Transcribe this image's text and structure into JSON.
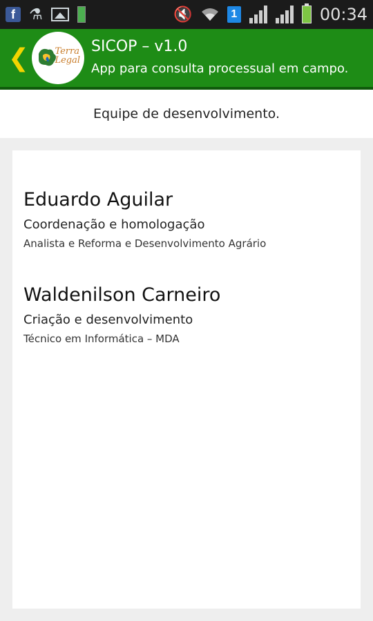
{
  "status_bar": {
    "left_icons": [
      "facebook-icon",
      "usb-icon",
      "gallery-icon",
      "battery-widget-icon"
    ],
    "right_icons": [
      "mute-icon",
      "wifi-icon",
      "sim-1-icon",
      "signal-icon",
      "signal-icon",
      "battery-charging-icon"
    ],
    "facebook_glyph": "f",
    "sim_label": "1",
    "time": "00:34"
  },
  "app_bar": {
    "title": "SICOP – v1.0",
    "subtitle": "App para consulta processual em campo.",
    "logo_text_line1": "Terra",
    "logo_text_line2": "Legal",
    "colors": {
      "background": "#1e8c16",
      "back_arrow": "#f2d500"
    }
  },
  "team_heading": "Equipe de desenvolvimento.",
  "members": [
    {
      "name": "Eduardo Aguilar",
      "role": "Coordenação e homologação",
      "title": "Analista e Reforma e Desenvolvimento Agrário"
    },
    {
      "name": "Waldenilson Carneiro",
      "role": "Criação e desenvolvimento",
      "title": "Técnico em Informática – MDA"
    }
  ]
}
